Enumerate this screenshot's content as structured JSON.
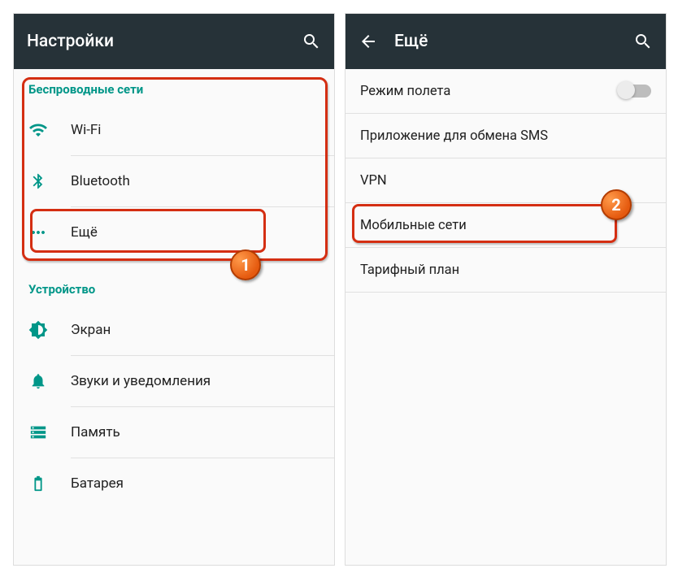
{
  "left": {
    "title": "Настройки",
    "section_wireless": "Беспроводные сети",
    "wifi": "Wi-Fi",
    "bluetooth": "Bluetooth",
    "more": "Ещё",
    "section_device": "Устройство",
    "display": "Экран",
    "sound": "Звуки и уведомления",
    "storage": "Память",
    "battery": "Батарея"
  },
  "right": {
    "title": "Ещё",
    "airplane": "Режим полета",
    "sms": "Приложение для обмена SMS",
    "vpn": "VPN",
    "mobile": "Мобильные сети",
    "plan": "Тарифный план"
  },
  "badges": {
    "one": "1",
    "two": "2"
  }
}
